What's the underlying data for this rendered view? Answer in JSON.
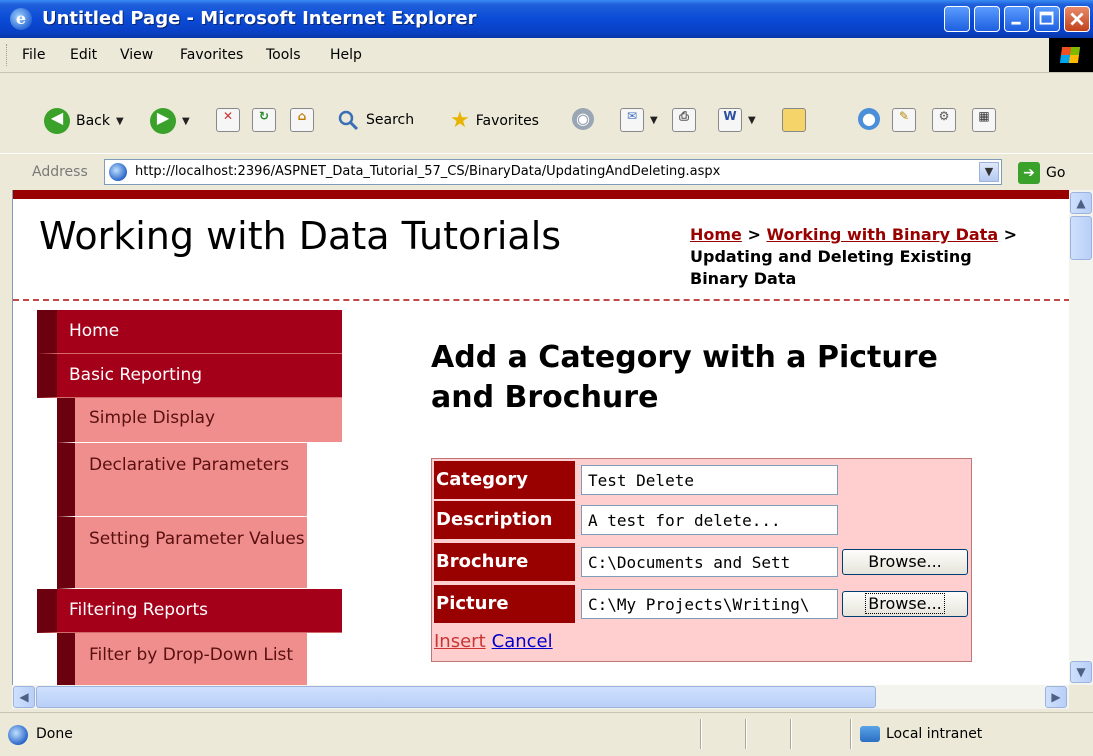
{
  "window": {
    "title": "Untitled Page - Microsoft Internet Explorer"
  },
  "menu": [
    "File",
    "Edit",
    "View",
    "Favorites",
    "Tools",
    "Help"
  ],
  "toolbar": {
    "back": "Back",
    "search": "Search",
    "favorites": "Favorites"
  },
  "address": {
    "label": "Address",
    "url": "http://localhost:2396/ASPNET_Data_Tutorial_57_CS/BinaryData/UpdatingAndDeleting.aspx",
    "go": "Go"
  },
  "page": {
    "site_title": "Working with Data Tutorials",
    "breadcrumb": {
      "home": "Home",
      "sep1": " > ",
      "section": "Working with Binary Data",
      "sep2": " > ",
      "current": "Updating and Deleting Existing Binary Data"
    },
    "heading": "Add a Category with a Picture and Brochure",
    "form": {
      "rows": [
        {
          "label": "Category",
          "value": "Test Delete"
        },
        {
          "label": "Description",
          "value": "A test for delete..."
        },
        {
          "label": "Brochure",
          "value": "C:\\Documents and Sett",
          "button": "Browse..."
        },
        {
          "label": "Picture",
          "value": "C:\\My Projects\\Writing\\",
          "button": "Browse..."
        }
      ],
      "insert": "Insert",
      "cancel": "Cancel"
    }
  },
  "sidebar": {
    "items": [
      {
        "label": "Home",
        "level": "top"
      },
      {
        "label": "Basic Reporting",
        "level": "top"
      },
      {
        "label": "Simple Display",
        "level": "sub"
      },
      {
        "label": "Declarative Parameters",
        "level": "sub"
      },
      {
        "label": "Setting Parameter Values",
        "level": "sub"
      },
      {
        "label": "Filtering Reports",
        "level": "top"
      },
      {
        "label": "Filter by Drop-Down List",
        "level": "sub"
      }
    ]
  },
  "status": {
    "text": "Done",
    "zone": "Local intranet"
  },
  "colors": {
    "accent": "#990000",
    "nav_top": "#a4001a",
    "nav_sub": "#f08e8e",
    "form_bg": "#ffcfcf"
  }
}
